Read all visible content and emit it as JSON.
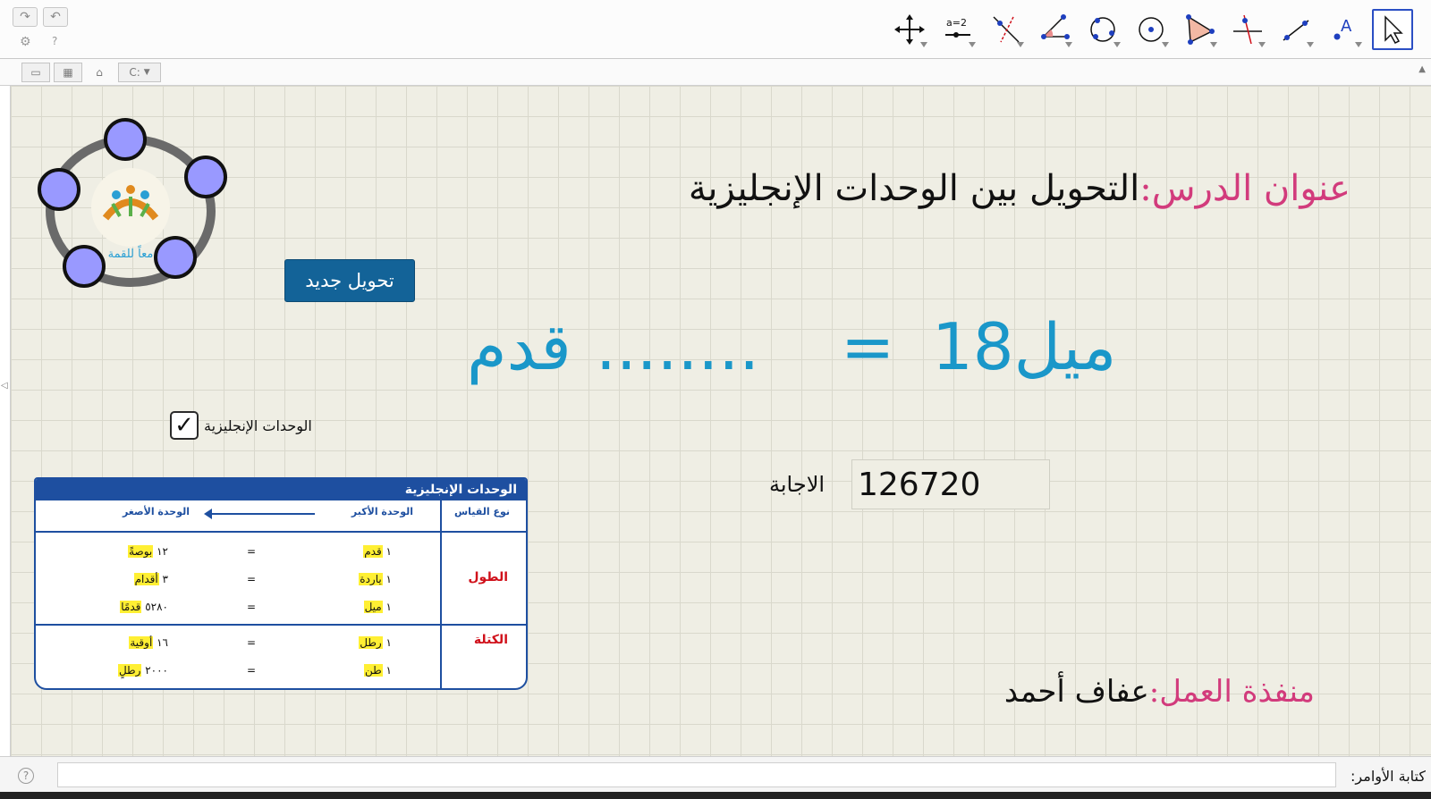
{
  "toolbar": {
    "redo_icon": "redo-icon",
    "undo_icon": "undo-icon",
    "settings_icon": "gear-icon",
    "help_icon": "help-icon",
    "tools": [
      "move",
      "slider",
      "line",
      "angle",
      "conic",
      "circle",
      "polygon",
      "perpendicular",
      "segment",
      "text",
      "select"
    ]
  },
  "graphics_header": {
    "perspectives_icon": "perspective-icon",
    "grid_icon": "grid-icon",
    "home_icon": "home-icon",
    "cas_selector": "C:"
  },
  "lesson": {
    "title_label": "عنوان الدرس:",
    "title_value": "التحويل بين الوحدات الإنجليزية"
  },
  "new_conversion_button": "تحويل جديد",
  "equation": {
    "number": "18",
    "from_unit": "ميل",
    "equals": "=",
    "dots": "........",
    "to_unit": "قدم"
  },
  "checkbox": {
    "label": "الوحدات الإنجليزية",
    "checked": true,
    "check_glyph": "✓"
  },
  "answer": {
    "label": "الاجابة",
    "value": "126720"
  },
  "units_table": {
    "title": "الوحدات الإنجليزية",
    "col_type": "نوع القياس",
    "col_larger": "الوحدة الأكبر",
    "col_smaller": "الوحدة الأصغر",
    "categories": [
      {
        "name": "الطول",
        "rows": [
          {
            "larger_num": "١",
            "larger_unit": "قدم",
            "eq": "=",
            "smaller_num": "١٢",
            "smaller_unit": "بوصةً"
          },
          {
            "larger_num": "١",
            "larger_unit": "ياردة",
            "eq": "=",
            "smaller_num": "٣",
            "smaller_unit": "أقدام"
          },
          {
            "larger_num": "١",
            "larger_unit": "ميل",
            "eq": "=",
            "smaller_num": "٥٢٨٠",
            "smaller_unit": "قدمًا"
          }
        ]
      },
      {
        "name": "الكتلة",
        "rows": [
          {
            "larger_num": "١",
            "larger_unit": "رطل",
            "eq": "=",
            "smaller_num": "١٦",
            "smaller_unit": "أوقية"
          },
          {
            "larger_num": "١",
            "larger_unit": "طن",
            "eq": "=",
            "smaller_num": "٢٠٠٠",
            "smaller_unit": "رطلٍ"
          }
        ]
      }
    ]
  },
  "author": {
    "label": "منفذة العمل:",
    "value": "عفاف أحمد"
  },
  "logo_text": "معاً للقمة",
  "input_bar": {
    "label": "كتابة الأوامر:",
    "value": "",
    "help_glyph": "?"
  },
  "colors": {
    "canvas_bg": "#efeee4",
    "accent_blue": "#1a97c9",
    "button_blue": "#136398",
    "title_pink": "#d23b7c",
    "table_blue": "#1e4fa0",
    "category_red": "#d0101a",
    "highlight": "#ffef33",
    "point_fill": "#9999ff"
  }
}
